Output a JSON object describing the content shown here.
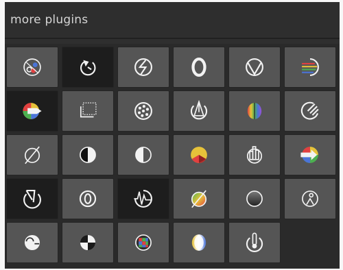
{
  "header": {
    "title": "more plugins"
  },
  "plugins": [
    {
      "icon": "colorbalance-icon"
    },
    {
      "icon": "rotation-icon"
    },
    {
      "icon": "crop-icon"
    },
    {
      "icon": "contrast-icon"
    },
    {
      "icon": "filmic-icon"
    },
    {
      "icon": "color-lines-icon"
    },
    {
      "icon": "rainbow-arrow-icon"
    },
    {
      "icon": "frame-icon"
    },
    {
      "icon": "dots-circle-icon"
    },
    {
      "icon": "compass-icon"
    },
    {
      "icon": "color-sphere-icon"
    },
    {
      "icon": "brush-strokes-icon"
    },
    {
      "icon": "empty-set-icon"
    },
    {
      "icon": "half-black-icon"
    },
    {
      "icon": "half-white-icon"
    },
    {
      "icon": "color-cube-icon"
    },
    {
      "icon": "levels-icon"
    },
    {
      "icon": "rainbow-arrow-right-icon"
    },
    {
      "icon": "distortion-icon"
    },
    {
      "icon": "lens-icon"
    },
    {
      "icon": "waveform-icon"
    },
    {
      "icon": "colored-slash-icon"
    },
    {
      "icon": "gradient-circle-icon"
    },
    {
      "icon": "person-circle-icon"
    },
    {
      "icon": "bubble-circle-icon"
    },
    {
      "icon": "quarter-circle-icon"
    },
    {
      "icon": "rgb-pixels-icon"
    },
    {
      "icon": "soft-glow-icon"
    },
    {
      "icon": "thermometer-icon"
    }
  ],
  "colors": {
    "background": "#2a2a2a",
    "button": "#555555",
    "button_active": "#1d1d1d",
    "text": "#d6d6d6",
    "icon": "#f2f2f2"
  }
}
